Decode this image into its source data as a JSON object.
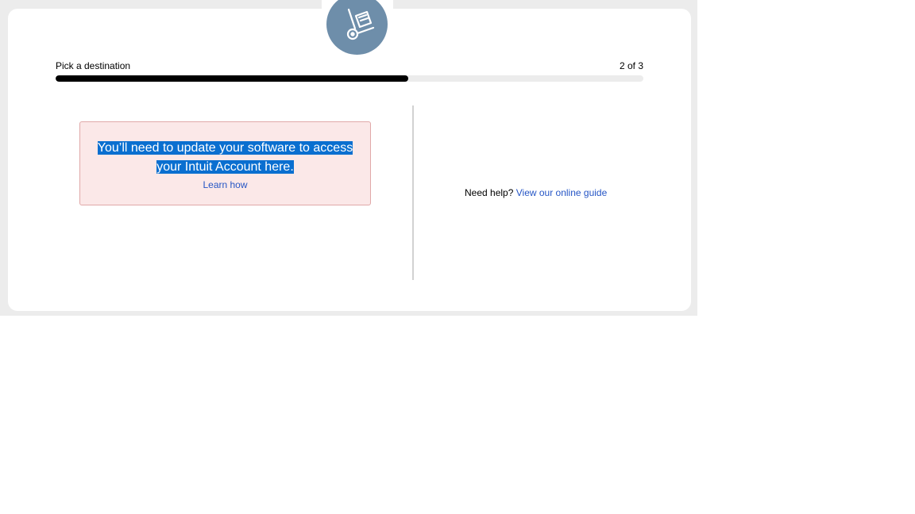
{
  "header": {
    "icon": "hand-truck-icon",
    "accent_color": "#6e8eaa"
  },
  "progress": {
    "step_label": "Pick a destination",
    "step_count": "2 of 3",
    "fraction": 0.6
  },
  "alert": {
    "message": "You’ll need to update your software to access your Intuit Account here.",
    "link_label": "Learn how"
  },
  "help": {
    "prefix": "Need help?",
    "link_label": "View our online guide"
  }
}
